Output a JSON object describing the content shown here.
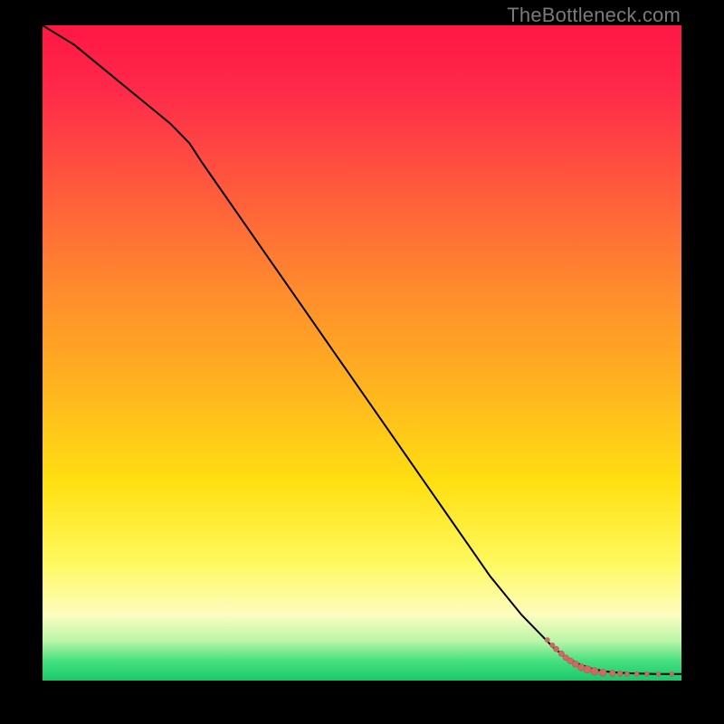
{
  "watermark": "TheBottleneck.com",
  "colors": {
    "line": "#000000",
    "marker_fill": "#cc6b66",
    "marker_stroke": "#b85650"
  },
  "chart_data": {
    "type": "line",
    "title": "",
    "xlabel": "",
    "ylabel": "",
    "xlim": [
      0,
      100
    ],
    "ylim": [
      0,
      100
    ],
    "series": [
      {
        "name": "curve",
        "x": [
          0,
          5,
          10,
          15,
          20,
          23,
          25,
          30,
          35,
          40,
          45,
          50,
          55,
          60,
          65,
          70,
          75,
          80,
          82,
          84,
          86,
          88,
          90,
          92,
          94,
          96,
          98,
          100
        ],
        "y": [
          100,
          97,
          93,
          89,
          85,
          82,
          79,
          72,
          65,
          58,
          51,
          44,
          37,
          30,
          23,
          16,
          10,
          5,
          3.5,
          2.5,
          1.8,
          1.4,
          1.2,
          1.1,
          1.05,
          1.0,
          1.0,
          1.0
        ]
      }
    ],
    "markers": {
      "name": "tail-points",
      "points": [
        {
          "x": 79.0,
          "y": 6.2,
          "r": 2.6
        },
        {
          "x": 79.8,
          "y": 5.4,
          "r": 2.6
        },
        {
          "x": 80.4,
          "y": 4.8,
          "r": 3.0
        },
        {
          "x": 81.2,
          "y": 4.1,
          "r": 3.2
        },
        {
          "x": 81.9,
          "y": 3.5,
          "r": 3.2
        },
        {
          "x": 82.6,
          "y": 3.0,
          "r": 3.4
        },
        {
          "x": 83.4,
          "y": 2.5,
          "r": 3.6
        },
        {
          "x": 84.3,
          "y": 2.0,
          "r": 3.8
        },
        {
          "x": 85.3,
          "y": 1.7,
          "r": 4.2
        },
        {
          "x": 86.4,
          "y": 1.4,
          "r": 4.2
        },
        {
          "x": 87.7,
          "y": 1.2,
          "r": 4.0
        },
        {
          "x": 89.2,
          "y": 1.1,
          "r": 3.4
        },
        {
          "x": 90.4,
          "y": 1.05,
          "r": 3.0
        },
        {
          "x": 91.5,
          "y": 1.0,
          "r": 2.6
        },
        {
          "x": 93.0,
          "y": 1.0,
          "r": 2.6
        },
        {
          "x": 94.6,
          "y": 1.0,
          "r": 2.4
        },
        {
          "x": 96.4,
          "y": 1.0,
          "r": 2.4
        },
        {
          "x": 98.5,
          "y": 1.0,
          "r": 2.4
        }
      ]
    }
  }
}
